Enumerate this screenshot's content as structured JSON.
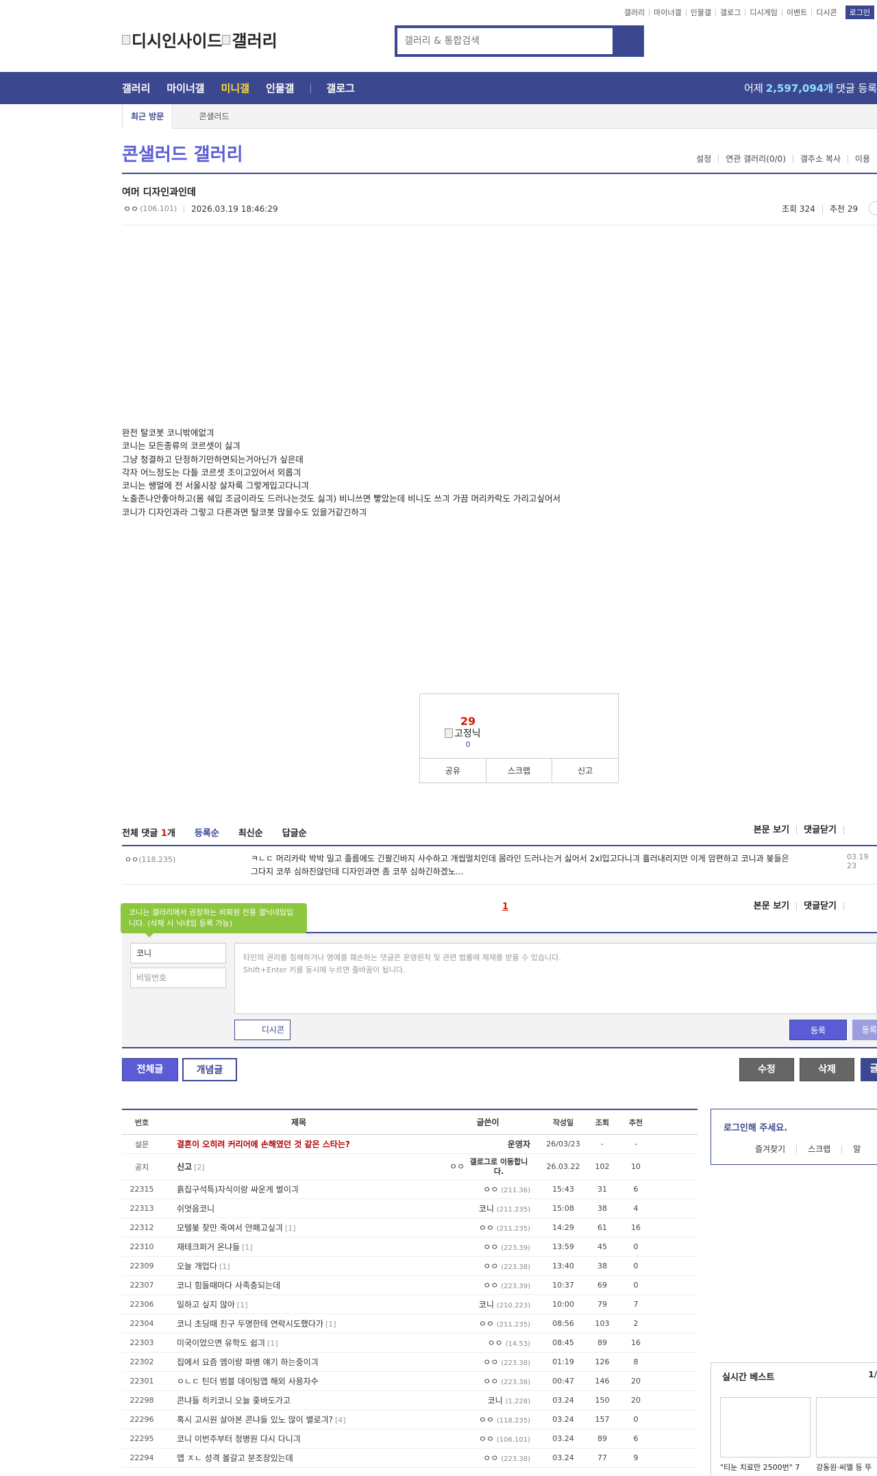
{
  "util_links": [
    "갤러리",
    "마이너갤",
    "인물갤",
    "갤로그",
    "디시게임",
    "이벤트",
    "디시콘"
  ],
  "login_label": "로그인",
  "logo": {
    "alt1": "디시인사이드",
    "alt2": "갤러리"
  },
  "search": {
    "placeholder": "갤러리 & 통합검색"
  },
  "gnb": {
    "items": [
      "갤러리",
      "마이너갤",
      "미니갤",
      "인물갤",
      "갤로그"
    ],
    "active": "미니갤",
    "count_prefix": "어제",
    "count_value": "2,597,094개",
    "count_suffix": "댓글 등록"
  },
  "visit": {
    "tab": "최근 방문",
    "item": "콘샐러드"
  },
  "gallery": {
    "title": "콘샐러드 갤러리",
    "options": [
      "설정",
      "연관 갤러리(0/0)",
      "갤주소 복사",
      "이용"
    ]
  },
  "post": {
    "title": "여머 디자인과인데",
    "author": "ㅇㅇ",
    "ip": "(106.101)",
    "date": "2026.03.19 18:46:29",
    "views": "조회 324",
    "recommend": "추천 29",
    "body": [
      "완전 탈코봇 코니밖에없긔",
      "코니는 모든종류의 코르셋이 싫긔",
      "그냥 청결하고 단정하기만하면되는거아닌가 싶은데",
      "각자 어느정도는 다들 코르셋 조이고있어서 외롭긔",
      "코니는 쌩얼에 전 서울시장 살자룩 그렇게입고다니긔",
      "노출존나안좋아하고(몸 쉐입 조금이라도 드러나는것도 싫긔) 비니쓰면 빻았는데 비니도 쓰긔 가끔 머리카락도 가리고싶어서",
      "코니가 디자인과라 그렇고 다른과면 탈코봇 많을수도 있을거같긴하긔"
    ]
  },
  "recommend_box": {
    "count": "29",
    "fixed_alt": "고정닉",
    "fixed_count": "0",
    "buttons": [
      "공유",
      "스크랩",
      "신고"
    ]
  },
  "comments": {
    "total_label": "전체 댓글",
    "total_count": "1",
    "total_suffix": "개",
    "sorts": [
      "등록순",
      "최신순",
      "답글순"
    ],
    "actions": [
      "본문 보기",
      "댓글닫기"
    ],
    "items": [
      {
        "nick": "ㅇㅇ",
        "ip": "(118.235)",
        "text": "ㅋㄴㄷ 머리카락 박박 밀고 졸름에도 긴팔긴바지 사수하고 개씹멀치인데 몸라인 드러나는거 싫어서 2xl입고다니긔 흘러내리지만 이게 맘편하고 코니과 봊들은 그다지 코쭈 심하진않던데 디자인과면 좀 코쭈 심하긴하겠노...",
        "date": "03.19 23"
      }
    ],
    "page": "1",
    "tip": "코니는 갤러리에서 권장하는 비회원 전용 갤닉네임입니다. (삭제 시 닉네임 등록 가능)",
    "nick_value": "코니",
    "pw_placeholder": "비밀번호",
    "textarea_line1": "타인의 권리를 침해하거나 명예를 훼손하는 댓글은 운영원칙 및 관련 법률에 제재를 받을 수 있습니다.",
    "textarea_line2": "Shift+Enter 키를 동시에 누르면 줄바꿈이 됩니다.",
    "dccon": "디시콘",
    "register": "등록",
    "register2": "등록"
  },
  "buttons": {
    "all": "전체글",
    "concept": "개념글",
    "edit": "수정",
    "delete": "삭제",
    "write": "글"
  },
  "list": {
    "headers": [
      "번호",
      "제목",
      "글쓴이",
      "작성일",
      "조회",
      "추천"
    ],
    "rows": [
      {
        "no": "설문",
        "sub": "결혼이 오히려 커리어에 손해였던 것 같은 스타는?",
        "cnt": "",
        "wr": "운영자",
        "ip": "",
        "dt": "26/03/23",
        "vw": "-",
        "rc": "-",
        "type": "survey"
      },
      {
        "no": "공지",
        "sub": "신고",
        "cnt": "[2]",
        "wr": "ㅇㅇ",
        "ip": "갤로그로 이동합니다.",
        "dt": "26.03.22",
        "vw": "102",
        "rc": "10",
        "type": "notice"
      },
      {
        "no": "22315",
        "sub": "흙집구석특)자식이랑 싸운게 벌이긔",
        "cnt": "",
        "wr": "ㅇㅇ",
        "ip": "(211.36)",
        "dt": "15:43",
        "vw": "31",
        "rc": "6"
      },
      {
        "no": "22313",
        "sub": "쉬엇음코니",
        "cnt": "",
        "wr": "코니",
        "ip": "(211.235)",
        "dt": "15:08",
        "vw": "38",
        "rc": "4"
      },
      {
        "no": "22312",
        "sub": "모텔봊 찾만 죽여서 안패고싶긔",
        "cnt": "[1]",
        "wr": "ㅇㅇ",
        "ip": "(211.235)",
        "dt": "14:29",
        "vw": "61",
        "rc": "16"
      },
      {
        "no": "22310",
        "sub": "재테크퍼거 온냐들",
        "cnt": "[1]",
        "wr": "ㅇㅇ",
        "ip": "(223.39)",
        "dt": "13:59",
        "vw": "45",
        "rc": "0"
      },
      {
        "no": "22309",
        "sub": "오늘 개업다",
        "cnt": "[1]",
        "wr": "ㅇㅇ",
        "ip": "(223.38)",
        "dt": "13:40",
        "vw": "38",
        "rc": "0"
      },
      {
        "no": "22307",
        "sub": "코니 힘들때마다 사족충되는데",
        "cnt": "",
        "wr": "ㅇㅇ",
        "ip": "(223.39)",
        "dt": "10:37",
        "vw": "69",
        "rc": "0"
      },
      {
        "no": "22306",
        "sub": "일하고 싶지 않아",
        "cnt": "[1]",
        "wr": "코니",
        "ip": "(210.223)",
        "dt": "10:00",
        "vw": "79",
        "rc": "7"
      },
      {
        "no": "22304",
        "sub": "코니 초딩때 친구 두명한테 연락시도했다가",
        "cnt": "[1]",
        "wr": "ㅇㅇ",
        "ip": "(211.235)",
        "dt": "08:56",
        "vw": "103",
        "rc": "2"
      },
      {
        "no": "22303",
        "sub": "미국이었으면 유학도 쉽긔",
        "cnt": "[1]",
        "wr": "ㅇㅇ",
        "ip": "(14.53)",
        "dt": "08:45",
        "vw": "89",
        "rc": "16"
      },
      {
        "no": "22302",
        "sub": "집에서 요즘 엠이랑 파병 얘기 하는중이긔",
        "cnt": "",
        "wr": "ㅇㅇ",
        "ip": "(223.38)",
        "dt": "01:19",
        "vw": "126",
        "rc": "8"
      },
      {
        "no": "22301",
        "sub": "ㅇㄴㄷ 틴더 범블 데이팅앱 해외 사용자수",
        "cnt": "",
        "wr": "ㅇㅇ",
        "ip": "(223.38)",
        "dt": "00:47",
        "vw": "146",
        "rc": "20"
      },
      {
        "no": "22298",
        "sub": "콘냐들 히키코니 오늘 줒바도가고",
        "cnt": "",
        "wr": "코니",
        "ip": "(1.228)",
        "dt": "03.24",
        "vw": "150",
        "rc": "20"
      },
      {
        "no": "22296",
        "sub": "혹시 고시원 살아본 콘냐들 있노 많이 별로긔?",
        "cnt": "[4]",
        "wr": "ㅇㅇ",
        "ip": "(118.235)",
        "dt": "03.24",
        "vw": "157",
        "rc": "0"
      },
      {
        "no": "22295",
        "sub": "코니 이번주부터 정병원 다시 다니긔",
        "cnt": "",
        "wr": "ㅇㅇ",
        "ip": "(106.101)",
        "dt": "03.24",
        "vw": "89",
        "rc": "6"
      },
      {
        "no": "22294",
        "sub": "앱 ㅈㄴ 성격 볼갈고 분조장있는데",
        "cnt": "",
        "wr": "ㅇㅇ",
        "ip": "(223.38)",
        "dt": "03.24",
        "vw": "77",
        "rc": "9"
      }
    ]
  },
  "side": {
    "login_title": "로그인해 주세요.",
    "login_links": [
      "즐겨찾기",
      "스크랩",
      "알"
    ],
    "best_title": "실시간 베스트",
    "best_page": "1/",
    "best_caps": [
      "\"티눈 치료만 2500번\" 7",
      "강동원·씨엘 등 뚜"
    ]
  }
}
